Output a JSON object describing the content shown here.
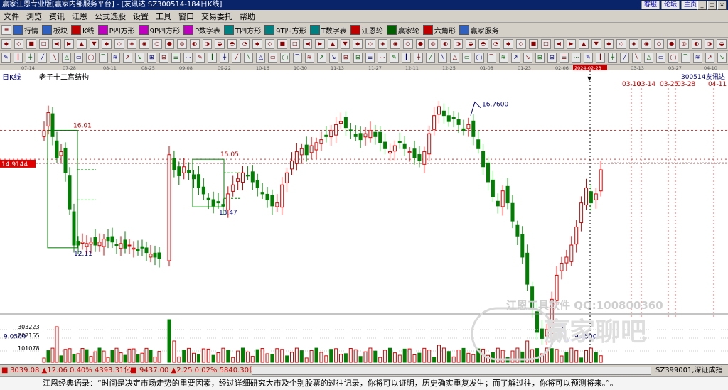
{
  "window": {
    "title": "赢家江恩专业版[赢家内部服务平台] - [友讯达  SZ300514-184日K线]",
    "links": [
      "客服",
      "论坛",
      "主页"
    ],
    "buttons": [
      "_",
      "□",
      "×"
    ]
  },
  "menu": [
    "文件",
    "浏览",
    "资讯",
    "江恩",
    "公式选股",
    "设置",
    "工具",
    "窗口",
    "交易委托",
    "帮助"
  ],
  "toolbar1": [
    {
      "label": "行情",
      "icon": "grid-icon",
      "color": "#3060c0"
    },
    {
      "label": "板块",
      "icon": "blocks-icon",
      "color": "#3060c0"
    },
    {
      "label": "K线",
      "icon": "kline-icon",
      "color": "#c00000"
    },
    {
      "label": "P四方形",
      "icon": "p-square-icon",
      "color": "#c000c0"
    },
    {
      "label": "9P四方形",
      "icon": "9p-square-icon",
      "color": "#c000c0"
    },
    {
      "label": "P数字表",
      "icon": "p-table-icon",
      "color": "#c000c0"
    },
    {
      "label": "T四方形",
      "icon": "t-square-icon",
      "color": "#008080"
    },
    {
      "label": "9T四方形",
      "icon": "9t-square-icon",
      "color": "#008080"
    },
    {
      "label": "T数字表",
      "icon": "t-table-icon",
      "color": "#008080"
    },
    {
      "label": "江恩轮",
      "icon": "wheel-icon",
      "color": "#c00000"
    },
    {
      "label": "赢家轮",
      "icon": "winner-wheel-icon",
      "color": "#006000"
    },
    {
      "label": "六角形",
      "icon": "hexagon-icon",
      "color": "#c00000"
    },
    {
      "label": "赢家服务",
      "icon": "service-icon",
      "color": "#3060c0"
    }
  ],
  "chart_label": "日K线",
  "chart_subtitle": "老子十二宫结构",
  "stock_code": "300514",
  "stock_name": "友讯达",
  "date_axis": [
    "07-14",
    "07-28",
    "08-11",
    "08-25",
    "09-08",
    "09-22",
    "10-16",
    "10-30",
    "11-13",
    "11-27",
    "12-11",
    "12-25",
    "01-08",
    "01-23",
    "02-06",
    "2024-02-23",
    "03-13",
    "03-27",
    "04-10"
  ],
  "future_dates": [
    "03-10",
    "03-14",
    "03-25",
    "03-28",
    "04-11"
  ],
  "price_marker": "14.9144",
  "price_labels": {
    "level_a": "16.01",
    "level_b": "15.05",
    "low_a": "12.11",
    "low_b": "13.47",
    "high": "16.7600",
    "low": "9.0500",
    "axis_low": "9.0500"
  },
  "volume_axis": [
    "303223",
    "202155",
    "101078"
  ],
  "watermark": "江恩工具软件 QQ:100800360",
  "watermark2": "赢家聊吧",
  "status": {
    "sh": "3039.08 ▲12.06 0.40% 4393.31亿",
    "sz": "9437.00 ▲2.25 0.02% 5840.30亿",
    "right": "SZ399001,深证成指"
  },
  "colors": {
    "up": "#e00000",
    "down": "#008000",
    "title_bg": "#0a246a"
  },
  "quote": "江恩经典语录：“时间是决定市场走势的重要因素，经过详细研究大市及个别股票的过往记录，你将可以证明，历史确实重复发生；而了解过往，你将可以预测将来。”。"
}
